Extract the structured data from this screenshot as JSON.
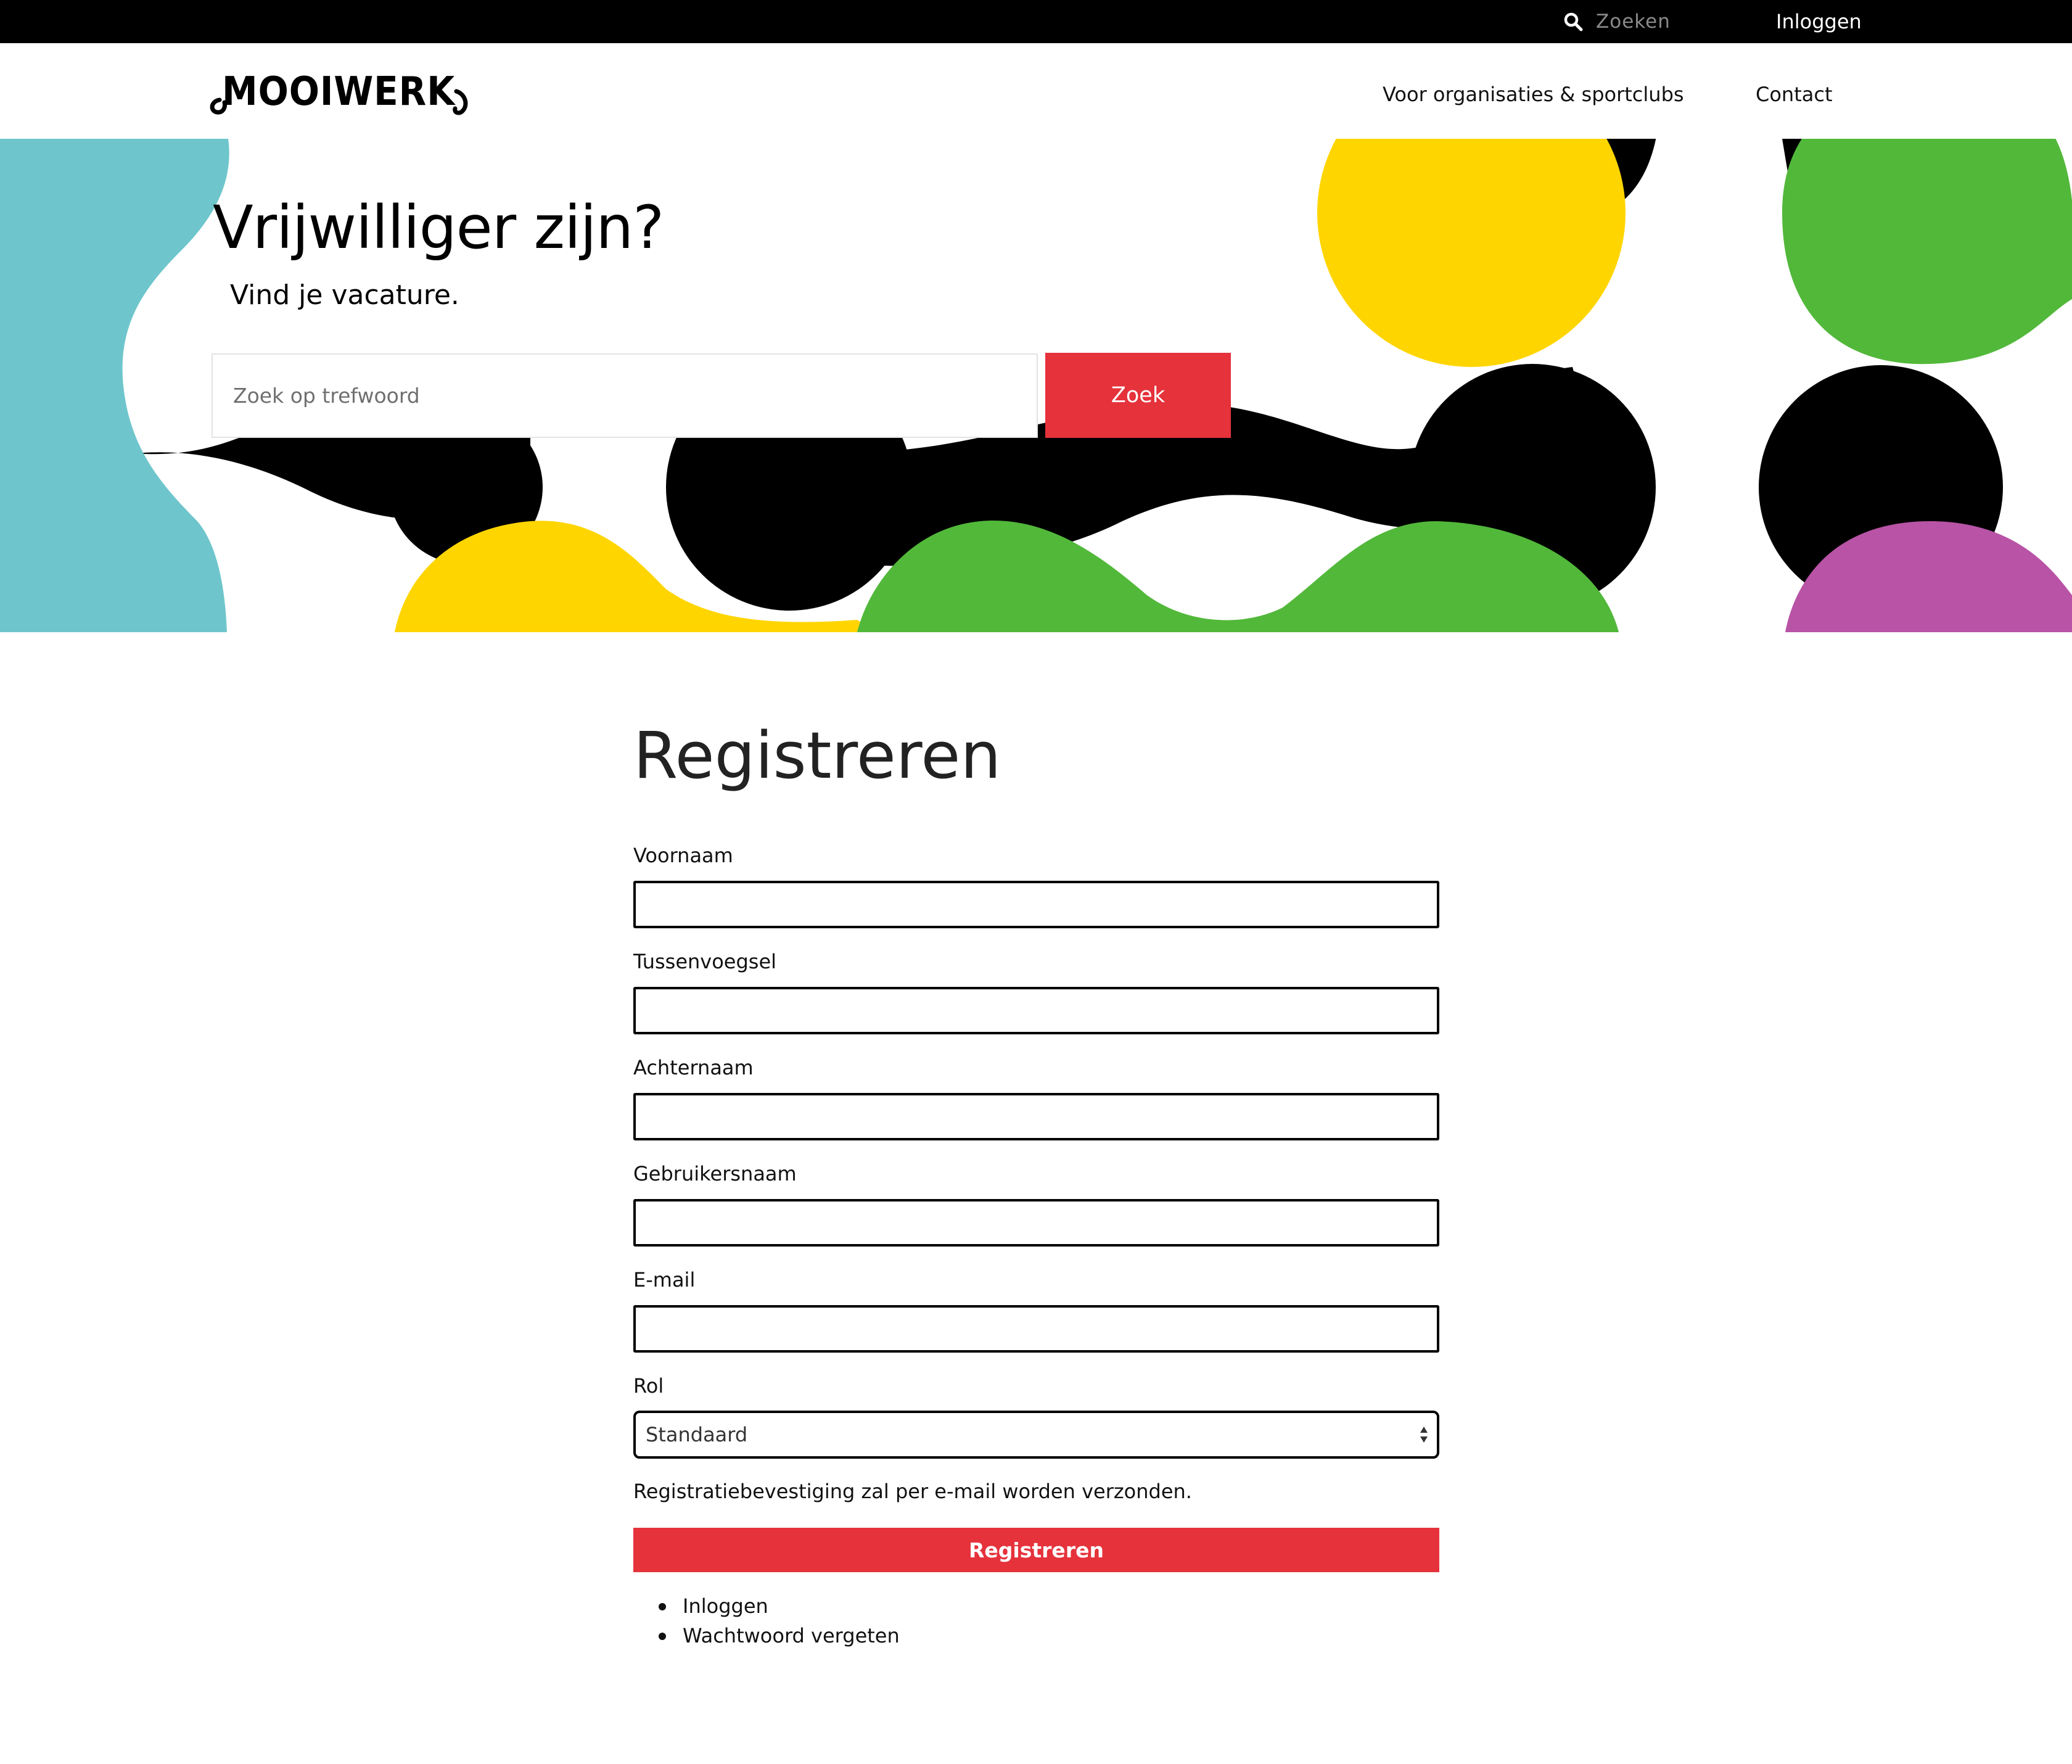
{
  "topbar": {
    "search_placeholder": "Zoeken",
    "login_label": "Inloggen"
  },
  "header": {
    "logo_text": "MOOIWERK",
    "nav": {
      "organisations": "Voor organisaties & sportclubs",
      "contact": "Contact"
    }
  },
  "hero": {
    "title": "Vrijwilliger zijn?",
    "subtitle": "Vind je vacature.",
    "search_placeholder": "Zoek op trefwoord",
    "search_button": "Zoek",
    "colors": {
      "teal": "#6ec6cc",
      "yellow": "#ffd500",
      "green": "#52b83a",
      "purple": "#b853a6",
      "black": "#000000"
    }
  },
  "form": {
    "title": "Registreren",
    "fields": [
      {
        "label": "Voornaam",
        "value": ""
      },
      {
        "label": "Tussenvoegsel",
        "value": ""
      },
      {
        "label": "Achternaam",
        "value": ""
      },
      {
        "label": "Gebruikersnaam",
        "value": ""
      },
      {
        "label": "E-mail",
        "value": ""
      }
    ],
    "role": {
      "label": "Rol",
      "selected": "Standaard"
    },
    "notice": "Registratiebevestiging zal per e-mail worden verzonden.",
    "submit_label": "Registreren",
    "links": [
      "Inloggen",
      "Wachtwoord vergeten"
    ],
    "accent_color": "#e5323b"
  }
}
